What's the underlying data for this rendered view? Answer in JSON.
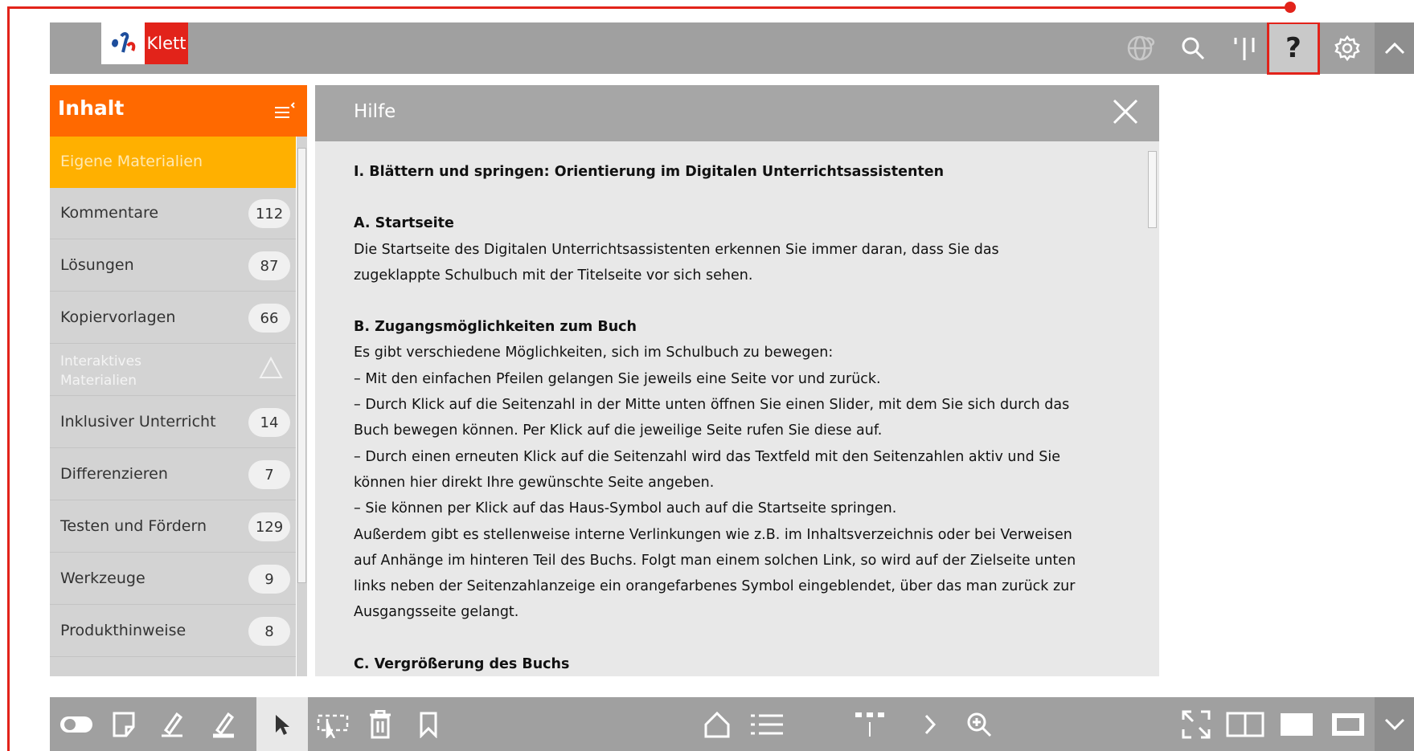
{
  "colors": {
    "accent": "#ff6900",
    "brand_red": "#e2231a",
    "highlight": "#ffb000",
    "bar": "#a0a0a0"
  },
  "topbar": {
    "logo_text": "Klett",
    "icons": [
      "globe-icon",
      "search-icon",
      "bookmark-bar-icon",
      "help-icon",
      "settings-icon",
      "collapse-up-icon"
    ],
    "help_label": "?"
  },
  "sidebar": {
    "title": "Inhalt",
    "items": [
      {
        "label": "Eigene Materialien",
        "count": ""
      },
      {
        "label": "Kommentare",
        "count": "112"
      },
      {
        "label": "Lösungen",
        "count": "87"
      },
      {
        "label": "Kopiervorlagen",
        "count": "66"
      },
      {
        "label": "Interaktives Materialien",
        "count": ""
      },
      {
        "label": "Inklusiver Unterricht",
        "count": "14"
      },
      {
        "label": "Differenzieren",
        "count": "7"
      },
      {
        "label": "Testen und Fördern",
        "count": "129"
      },
      {
        "label": "Werkzeuge",
        "count": "9"
      },
      {
        "label": "Produkthinweise",
        "count": "8"
      }
    ]
  },
  "panel": {
    "title": "Hilfe",
    "heading1": "I. Blättern und springen: Orientierung im Digitalen Unterrichtsassistenten",
    "a_title": "A. Startseite",
    "a_l1": "Die Startseite des Digitalen Unterrichtsassistenten erkennen Sie immer daran, dass Sie das",
    "a_l2": "zugeklappte Schulbuch mit der Titelseite vor sich sehen.",
    "b_title": "B. Zugangsmöglichkeiten zum Buch",
    "b_l1": "Es gibt verschiedene Möglichkeiten, sich im Schulbuch zu bewegen:",
    "b_l2": "– Mit den einfachen Pfeilen gelangen Sie jeweils eine Seite vor und zurück.",
    "b_l3": "– Durch Klick auf die Seitenzahl in der Mitte unten öffnen Sie einen Slider, mit dem Sie sich durch das",
    "b_l4": "Buch bewegen können. Per Klick auf die jeweilige Seite rufen Sie diese auf.",
    "b_l5": "– Durch einen erneuten Klick auf die Seitenzahl wird das Textfeld mit den Seitenzahlen aktiv und Sie",
    "b_l6": "können hier direkt Ihre gewünschte Seite angeben.",
    "b_l7": "– Sie können per Klick auf das Haus-Symbol auch auf die Startseite springen.",
    "b_l8": "Außerdem gibt es stellenweise interne Verlinkungen wie z.B. im Inhaltsverzeichnis oder bei Verweisen",
    "b_l9": "auf Anhänge im hinteren Teil des Buchs. Folgt man einem solchen Link, so wird auf der Zielseite unten",
    "b_l10": "links neben der Seitenzahlanzeige ein orangefarbenes Symbol eingeblendet, über das man zurück zur",
    "b_l11": "Ausgangsseite gelangt.",
    "c_title": "C. Vergrößerung des Buchs"
  },
  "bottombar": {
    "icons": [
      "toggle-icon",
      "note-icon",
      "pen-icon",
      "highlighter-icon",
      "pointer-icon",
      "select-area-icon",
      "trash-icon",
      "bookmark-icon",
      "home-icon",
      "list-icon",
      "page-slider-icon",
      "next-page-icon",
      "zoom-in-icon",
      "fullscreen-icon",
      "double-page-icon",
      "single-page-icon",
      "window-page-icon",
      "collapse-down-icon"
    ]
  }
}
